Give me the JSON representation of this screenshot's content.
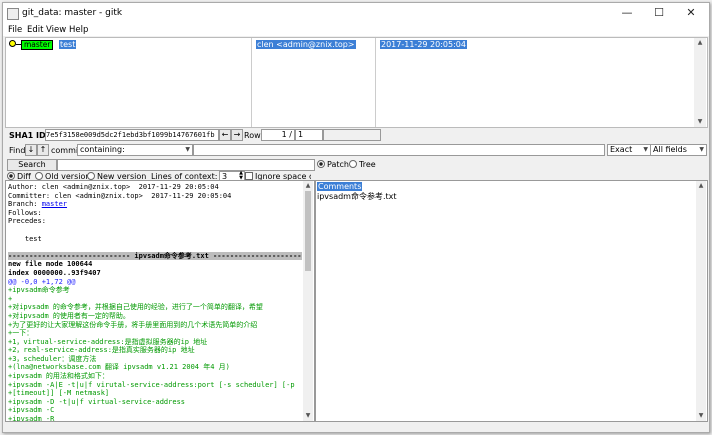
{
  "window": {
    "title": "git_data: master - gitk",
    "min_glyph": "—",
    "max_glyph": "☐",
    "close_glyph": "✕"
  },
  "menu": [
    "File",
    "Edit",
    "View",
    "Help"
  ],
  "history": {
    "commit": {
      "branch": "master",
      "subject": "test",
      "author": "clen <admin@znix.top>",
      "date": "2017-11-29 20:05:04"
    }
  },
  "sha": {
    "label": "SHA1 ID:",
    "value": "7e5f3158e009d5dc2f1ebd3bf1099b14767601fb",
    "row_label": "Row",
    "row_current": "1 /",
    "row_total": "1"
  },
  "find": {
    "label": "Find",
    "commit_label": "commit",
    "mode": "containing:",
    "match": "Exact",
    "fields": "All fields"
  },
  "search": {
    "button": "Search",
    "diff": "Diff",
    "old_version": "Old version",
    "new_version": "New version",
    "context_label": "Lines of context:",
    "context_value": "3",
    "ignore_space": "Ignore space chang"
  },
  "right_pane": {
    "patch": "Patch",
    "tree": "Tree",
    "comments": "Comments",
    "file": "ipvsadm命令参考.txt"
  },
  "diff_lines": [
    {
      "type": "meta",
      "text": "Author: clen <admin@znix.top>  2017-11-29 20:05:04"
    },
    {
      "type": "meta",
      "text": "Committer: clen <admin@znix.top>  2017-11-29 20:05:04"
    },
    {
      "type": "link",
      "text": "Branch: ",
      "link": "master"
    },
    {
      "type": "meta",
      "text": "Follows:"
    },
    {
      "type": "meta",
      "text": "Precedes:"
    },
    {
      "type": "meta",
      "text": ""
    },
    {
      "type": "meta",
      "text": "    test"
    },
    {
      "type": "meta",
      "text": ""
    },
    {
      "type": "file",
      "text": "----------------------------- ipvsadm命令参考.txt -----------------------"
    },
    {
      "type": "bold",
      "text": "new file mode 100644"
    },
    {
      "type": "bold",
      "text": "index 0000000..93f9407"
    },
    {
      "type": "hunk",
      "text": "@@ -0,0 +1,72 @@"
    },
    {
      "type": "add",
      "text": "+ipvsadm命令参考"
    },
    {
      "type": "add",
      "text": "+"
    },
    {
      "type": "add",
      "text": "+对ipvsadm 的命令参考，并根据自己使用的经验，进行了一个简单的翻译，希望"
    },
    {
      "type": "add",
      "text": "+对ipvsadm 的使用者有一定的帮助。"
    },
    {
      "type": "add",
      "text": "+为了更好的让大家理解这份命令手册，将手册里面用到的几个术语先简单的介绍"
    },
    {
      "type": "add",
      "text": "+一下："
    },
    {
      "type": "add",
      "text": "+1，virtual-service-address:是指虚拟服务器的ip 地址"
    },
    {
      "type": "add",
      "text": "+2，real-service-address:是指真实服务器的ip 地址"
    },
    {
      "type": "add",
      "text": "+3，scheduler：调度方法"
    },
    {
      "type": "add",
      "text": "+(lna@networksbase.com 翻译 ipvsadm v1.21 2004 年4 月)"
    },
    {
      "type": "add",
      "text": "+ipvsadm 的用法和格式如下："
    },
    {
      "type": "add",
      "text": "+ipvsadm -A|E -t|u|f virutal-service-address:port [-s scheduler] [-p"
    },
    {
      "type": "add",
      "text": "+[timeout]] [-M netmask]"
    },
    {
      "type": "add",
      "text": "+ipvsadm -D -t|u|f virtual-service-address"
    },
    {
      "type": "add",
      "text": "+ipvsadm -C"
    },
    {
      "type": "add",
      "text": "+ipvsadm -R"
    },
    {
      "type": "add",
      "text": "+ipvsadm -S [-n]"
    }
  ]
}
